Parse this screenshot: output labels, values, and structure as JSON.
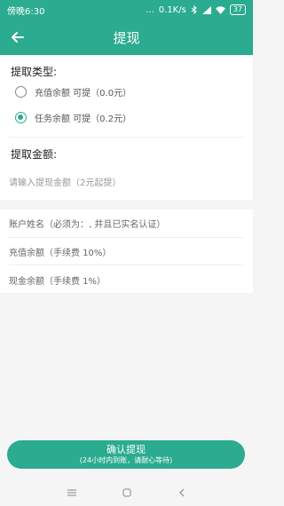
{
  "status": {
    "time": "傍晚6:30",
    "signal": "...",
    "speed": "0.1K/s",
    "battery": "37"
  },
  "header": {
    "title": "提现"
  },
  "withdraw_type": {
    "label": "提取类型:",
    "options": [
      {
        "text": "充值余额 可提（0.0元）",
        "checked": false
      },
      {
        "text": "任务余额 可提（0.2元）",
        "checked": true
      }
    ]
  },
  "amount": {
    "label": "提取金额:",
    "placeholder": "请输入提现金额（2元起提）"
  },
  "info": {
    "account_name": "账户姓名（必须为：, 并且已实名认证）",
    "recharge_balance": "充值余额（手续费 10%）",
    "cash_balance": "现金余额（手续费 1%）"
  },
  "confirm": {
    "label": "确认提现",
    "sub": "(24小时内到账，请耐心等待)"
  },
  "colors": {
    "accent": "#2bab8f"
  }
}
